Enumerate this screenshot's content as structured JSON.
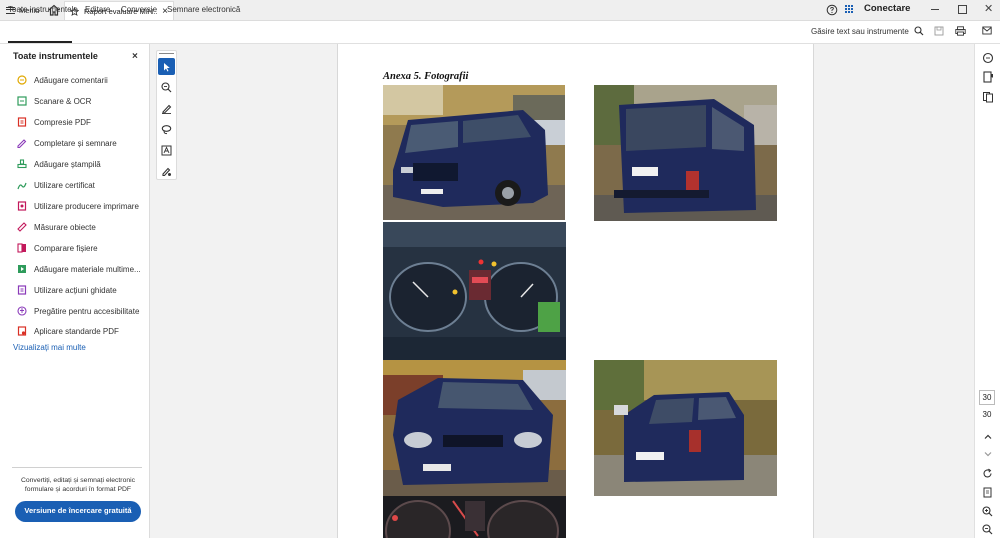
{
  "titlebar": {
    "menu_label": "Meniu",
    "doc_tab_title": "Raport evaluare MIN...",
    "doc_tab_close": "×",
    "connect_label": "Conectare",
    "window_close": "✕"
  },
  "menurow": {
    "tabs": [
      "Toate instrumentele",
      "Editare",
      "Conversie",
      "Semnare electronică"
    ],
    "search_label": "Găsire text sau instrumente"
  },
  "panel": {
    "title": "Toate instrumentele",
    "close": "×",
    "items": [
      {
        "label": "Adăugare comentarii",
        "icon": "comment-icon",
        "color": "#e0a800"
      },
      {
        "label": "Scanare & OCR",
        "icon": "scan-icon",
        "color": "#2e9b5b"
      },
      {
        "label": "Compresie PDF",
        "icon": "compress-icon",
        "color": "#d93025"
      },
      {
        "label": "Completare și semnare",
        "icon": "sign-icon",
        "color": "#8a3ab9"
      },
      {
        "label": "Adăugare ștampilă",
        "icon": "stamp-icon",
        "color": "#2e9b5b"
      },
      {
        "label": "Utilizare certificat",
        "icon": "certificate-icon",
        "color": "#2e9b5b"
      },
      {
        "label": "Utilizare producere imprimare",
        "icon": "print-production-icon",
        "color": "#c2185b"
      },
      {
        "label": "Măsurare obiecte",
        "icon": "measure-icon",
        "color": "#c2185b"
      },
      {
        "label": "Comparare fișiere",
        "icon": "compare-icon",
        "color": "#c2185b"
      },
      {
        "label": "Adăugare materiale multime...",
        "icon": "multimedia-icon",
        "color": "#2e9b5b"
      },
      {
        "label": "Utilizare acțiuni ghidate",
        "icon": "guided-actions-icon",
        "color": "#8a3ab9"
      },
      {
        "label": "Pregătire pentru accesibilitate",
        "icon": "accessibility-icon",
        "color": "#8a3ab9"
      },
      {
        "label": "Aplicare standarde PDF",
        "icon": "pdf-standards-icon",
        "color": "#d93025"
      }
    ],
    "see_more": "Vizualizați mai multe",
    "promo_text": "Convertiți, editați și semnați electronic formulare și acorduri în format PDF",
    "trial_button": "Versiune de încercare gratuită"
  },
  "document": {
    "annex_title": "Anexa 5. Fotografii",
    "photos": [
      {
        "id": "front-van",
        "desc": "blue van front"
      },
      {
        "id": "rear-van",
        "desc": "blue van rear"
      },
      {
        "id": "dashboard",
        "desc": "instrument cluster"
      },
      {
        "id": "front-wagon",
        "desc": "blue wagon front"
      },
      {
        "id": "rear-wagon",
        "desc": "blue wagon rear"
      },
      {
        "id": "cluster-2",
        "desc": "second instrument cluster"
      }
    ]
  },
  "rightrail": {
    "current_page": "30",
    "total_pages": "30"
  },
  "colors": {
    "accent": "#1a5fb4",
    "car_blue": "#1f2a5c",
    "autumn": "#a07a2a"
  }
}
